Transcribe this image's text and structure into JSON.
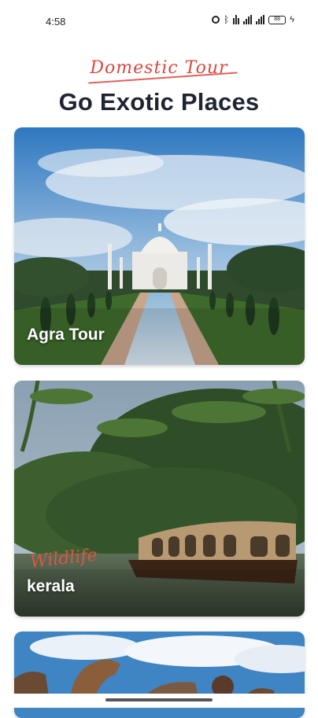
{
  "status_bar": {
    "time": "4:58",
    "battery_level": "88"
  },
  "header": {
    "script_title": "Domestic Tour",
    "title": "Go Exotic Places"
  },
  "cards": [
    {
      "label": "Agra Tour",
      "tag": "",
      "image_icon": "taj-mahal-illustration"
    },
    {
      "label": "kerala",
      "tag": "Wildlife",
      "image_icon": "houseboat-illustration"
    },
    {
      "label": "",
      "tag": "",
      "image_icon": "desert-camel-illustration"
    }
  ],
  "colors": {
    "accent_script": "#d9473f",
    "title": "#1f2433"
  }
}
